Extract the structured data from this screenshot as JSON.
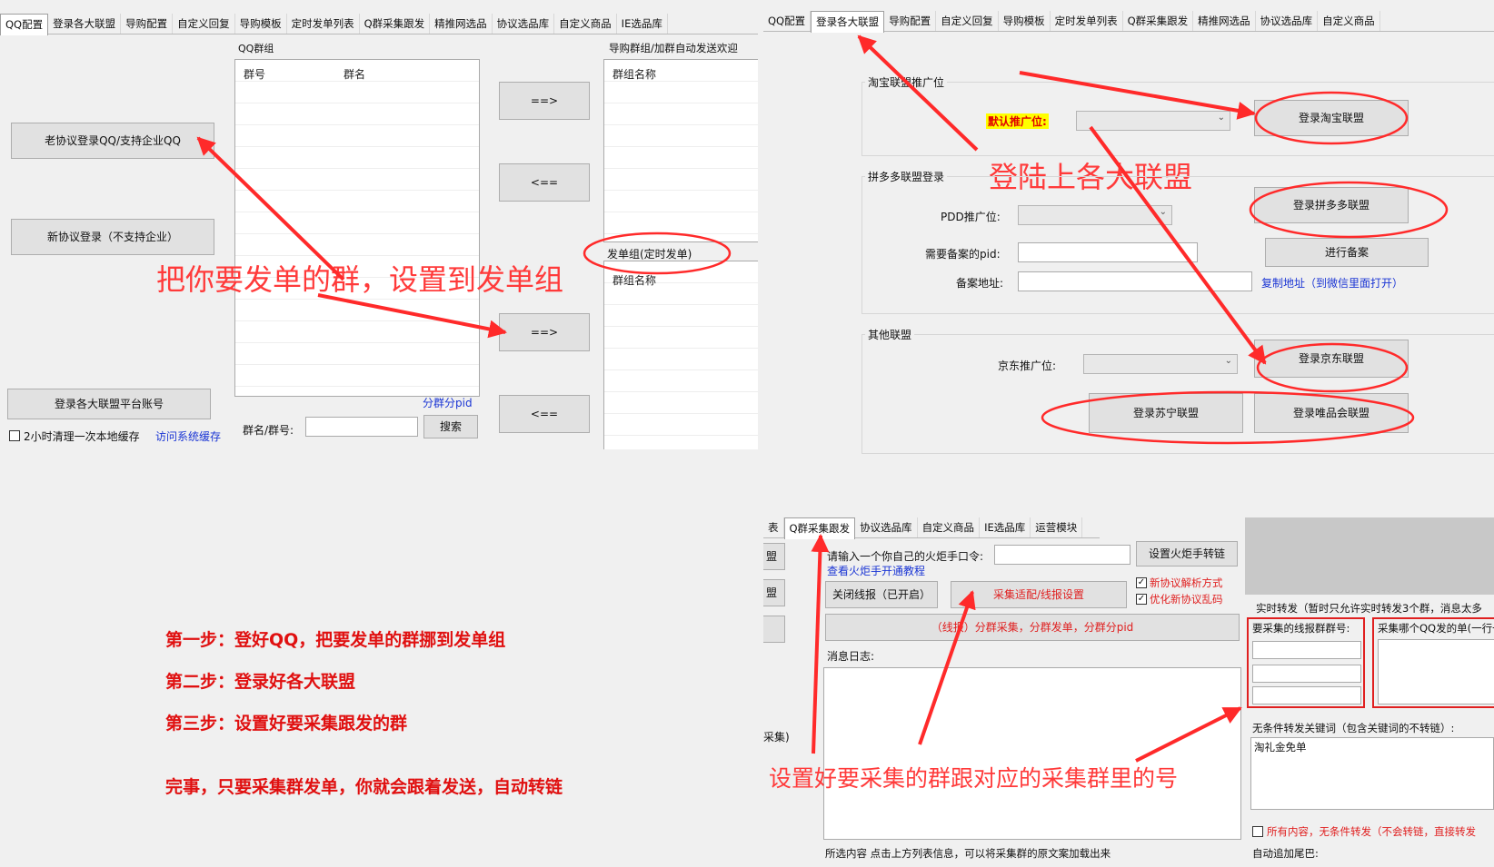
{
  "p1": {
    "tabs": [
      "QQ配置",
      "登录各大联盟",
      "导购配置",
      "自定义回复",
      "导购模板",
      "定时发单列表",
      "Q群采集跟发",
      "精推网选品",
      "协议选品库",
      "自定义商品",
      "IE选品库"
    ],
    "qq_group_title": "QQ群组",
    "col_group_no": "群号",
    "col_group_name": "群名",
    "guide_group_title": "导购群组/加群自动发送欢迎",
    "col_group_name2": "群组名称",
    "send_group_label": "发单组(定时发单)",
    "col_group_name3": "群组名称",
    "btn_old_login": "老协议登录QQ/支持企业QQ",
    "btn_new_login": "新协议登录（不支持企业）",
    "btn_move_right": "==>",
    "btn_move_left": "<==",
    "btn_login_union": "登录各大联盟平台账号",
    "clear_cache_label": "2小时清理一次本地缓存",
    "visit_cache_link": "访问系统缓存",
    "pid_link": "分群分pid",
    "search_label": "群名/群号:",
    "search_btn": "搜索",
    "annotation": "把你要发单的群，设置到发单组"
  },
  "p2": {
    "tabs": [
      "QQ配置",
      "登录各大联盟",
      "导购配置",
      "自定义回复",
      "导购模板",
      "定时发单列表",
      "Q群采集跟发",
      "精推网选品",
      "协议选品库",
      "自定义商品"
    ],
    "taobao_group": "淘宝联盟推广位",
    "default_pid_label": "默认推广位:",
    "btn_login_taobao": "登录淘宝联盟",
    "annotation": "登陆上各大联盟",
    "pdd_group": "拼多多联盟登录",
    "pdd_pid_label": "PDD推广位:",
    "btn_login_pdd": "登录拼多多联盟",
    "record_pid_label": "需要备案的pid:",
    "btn_record": "进行备案",
    "record_url_label": "备案地址:",
    "copy_link": "复制地址（到微信里面打开）",
    "other_group": "其他联盟",
    "jd_pid_label": "京东推广位:",
    "btn_login_jd": "登录京东联盟",
    "btn_login_suning": "登录苏宁联盟",
    "btn_login_vip": "登录唯品会联盟"
  },
  "p3": {
    "tabs": [
      "表",
      "Q群采集跟发",
      "协议选品库",
      "自定义商品",
      "IE选品库",
      "运营模块"
    ],
    "side_btn_1": "盟",
    "side_btn_2": "盟",
    "side_label_collect": "采集)",
    "torch_label": "请输入一个你自己的火炬手口令:",
    "btn_set_torch": "设置火炬手转链",
    "torch_tutorial_link": "查看火炬手开通教程",
    "chk_new_protocol": "新协议解析方式",
    "chk_optimize": "优化新协议乱码",
    "btn_close_report": "关闭线报（已开启）",
    "btn_collect_settings": "采集适配/线报设置",
    "banner_text": "（线报）分群采集，分群发单，分群分pid",
    "log_label": "消息日志:",
    "bottom_label": "所选内容 点击上方列表信息，可以将采集群的原文案加载出来",
    "realtime_label": "实时转发（暂时只允许实时转发3个群，消息太多",
    "collect_group_label": "要采集的线报群群号:",
    "collect_qq_label": "采集哪个QQ发的单(一行一",
    "keyword_label": "无条件转发关键词（包含关键词的不转链）:",
    "keyword_value": "淘礼金免单",
    "all_forward_label": "所有内容，无条件转发（不会转链，直接转发",
    "tail_label": "自动追加尾巴:",
    "annotation": "设置好要采集的群跟对应的采集群里的号"
  },
  "steps": {
    "step1": "第一步：登好QQ，把要发单的群挪到发单组",
    "step2": "第二步：登录好各大联盟",
    "step3": "第三步：设置好要采集跟发的群",
    "done": "完事，只要采集群发单，你就会跟着发送，自动转链"
  },
  "colors": {
    "annotation_red": "#ff3a3a",
    "step_red": "#e01010",
    "link_blue": "#1a35d4",
    "highlight_yellow": "#ffff00"
  }
}
